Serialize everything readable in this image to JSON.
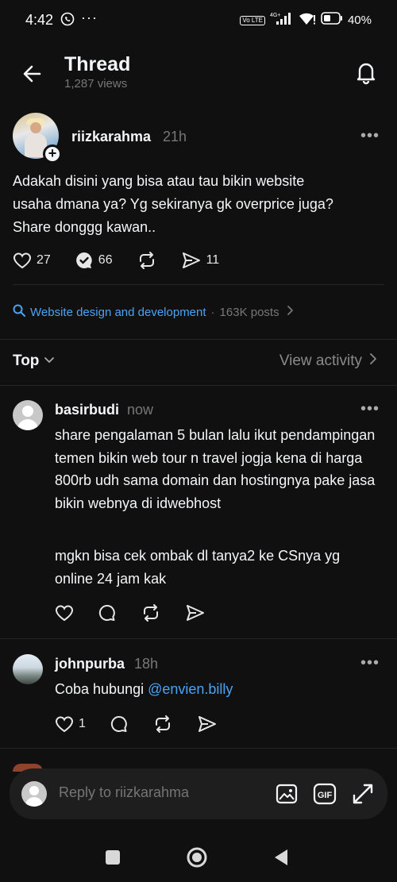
{
  "status_bar": {
    "time": "4:42",
    "volte": "Vo LTE",
    "network": "4G+",
    "battery": "40%"
  },
  "header": {
    "title": "Thread",
    "views": "1,287 views"
  },
  "post": {
    "username": "riizkarahma",
    "time": "21h",
    "text": "Adakah disini yang bisa atau tau bikin website\nusaha dmana ya? Yg sekiranya gk overprice juga?\nShare donggg kawan..",
    "likes": "27",
    "replies": "66",
    "shares": "11"
  },
  "topic": {
    "label": "Website design and development",
    "separator": "·",
    "posts": "163K posts"
  },
  "sort": {
    "label": "Top",
    "view_activity": "View activity"
  },
  "replies": [
    {
      "username": "basirbudi",
      "time": "now",
      "paragraph1": "share pengalaman 5 bulan lalu ikut pendampingan temen bikin web tour n travel jogja kena di harga 800rb udh sama domain dan hostingnya pake jasa bikin webnya di idwebhost",
      "paragraph2": "mgkn bisa cek ombak dl tanya2 ke CSnya yg online 24 jam kak",
      "likes": ""
    },
    {
      "username": "johnpurba",
      "time": "18h",
      "text_prefix": "Coba hubungi ",
      "mention": "@envien.billy",
      "likes": "1"
    }
  ],
  "composer": {
    "placeholder": "Reply to riizkarahma"
  },
  "colors": {
    "background": "#101010",
    "link": "#4aa3f5",
    "muted": "#777777",
    "composer": "#1e1e1e"
  },
  "icons": [
    "back-arrow-icon",
    "bell-icon",
    "heart-icon",
    "reply-check-icon",
    "repost-icon",
    "send-icon",
    "comment-icon",
    "search-icon",
    "chevron-right-icon",
    "chevron-down-icon",
    "image-icon",
    "gif-icon",
    "expand-icon"
  ]
}
